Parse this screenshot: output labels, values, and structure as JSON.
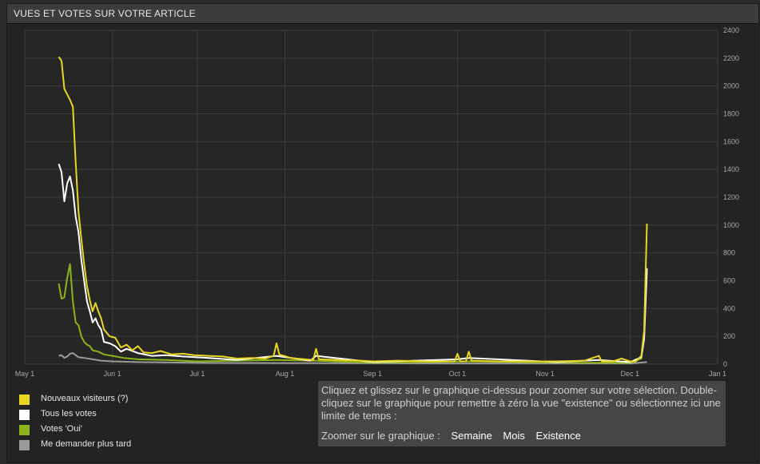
{
  "header": {
    "title": "VUES ET VOTES SUR VOTRE ARTICLE"
  },
  "legend": [
    {
      "label": "Nouveaux visiteurs (?)",
      "color": "#e8d622"
    },
    {
      "label": "Tous les votes",
      "color": "#ffffff"
    },
    {
      "label": "Votes 'Oui'",
      "color": "#8cb418"
    },
    {
      "label": "Me demander plus tard",
      "color": "#9a9a9a"
    }
  ],
  "info": {
    "text": "Cliquez et glissez sur le graphique ci-dessus pour zoomer sur votre sélection. Double-cliquez sur le graphique pour remettre à zéro la vue \"existence\" ou sélectionnez ici une limite de temps :",
    "zoom_label": "Zoomer sur le graphique :",
    "zoom_week": "Semaine",
    "zoom_month": "Mois",
    "zoom_all": "Existence"
  },
  "chart_data": {
    "type": "line",
    "x_tick_labels": [
      "May 1",
      "Jun 1",
      "Jul 1",
      "Aug 1",
      "Sep 1",
      "Oct 1",
      "Nov 1",
      "Dec 1",
      "Jan 1"
    ],
    "y_tick_labels": [
      "0",
      "200",
      "400",
      "600",
      "800",
      "1000",
      "1200",
      "1400",
      "1600",
      "1800",
      "2000",
      "2200",
      "2400"
    ],
    "ylim": [
      0,
      2400
    ],
    "grid": true,
    "legend_position": "bottom-left",
    "series": [
      {
        "name": "Nouveaux visiteurs (?)",
        "color": "#e8d622",
        "points": [
          [
            "2012-05-13",
            2210
          ],
          [
            "2012-05-14",
            2180
          ],
          [
            "2012-05-15",
            1980
          ],
          [
            "2012-05-17",
            1900
          ],
          [
            "2012-05-18",
            1850
          ],
          [
            "2012-05-19",
            1450
          ],
          [
            "2012-05-20",
            1100
          ],
          [
            "2012-05-21",
            900
          ],
          [
            "2012-05-22",
            720
          ],
          [
            "2012-05-23",
            560
          ],
          [
            "2012-05-24",
            460
          ],
          [
            "2012-05-25",
            380
          ],
          [
            "2012-05-26",
            440
          ],
          [
            "2012-05-27",
            380
          ],
          [
            "2012-05-28",
            330
          ],
          [
            "2012-05-29",
            250
          ],
          [
            "2012-05-31",
            200
          ],
          [
            "2012-06-02",
            190
          ],
          [
            "2012-06-04",
            120
          ],
          [
            "2012-06-06",
            140
          ],
          [
            "2012-06-08",
            100
          ],
          [
            "2012-06-10",
            130
          ],
          [
            "2012-06-12",
            85
          ],
          [
            "2012-06-15",
            80
          ],
          [
            "2012-06-18",
            95
          ],
          [
            "2012-06-22",
            70
          ],
          [
            "2012-06-26",
            75
          ],
          [
            "2012-06-30",
            65
          ],
          [
            "2012-07-05",
            60
          ],
          [
            "2012-07-10",
            55
          ],
          [
            "2012-07-15",
            40
          ],
          [
            "2012-07-20",
            45
          ],
          [
            "2012-07-25",
            40
          ],
          [
            "2012-07-28",
            60
          ],
          [
            "2012-07-29",
            150
          ],
          [
            "2012-07-30",
            70
          ],
          [
            "2012-08-03",
            45
          ],
          [
            "2012-08-08",
            35
          ],
          [
            "2012-08-11",
            30
          ],
          [
            "2012-08-12",
            110
          ],
          [
            "2012-08-13",
            35
          ],
          [
            "2012-08-20",
            30
          ],
          [
            "2012-08-28",
            25
          ],
          [
            "2012-09-01",
            20
          ],
          [
            "2012-09-10",
            25
          ],
          [
            "2012-09-20",
            20
          ],
          [
            "2012-09-30",
            20
          ],
          [
            "2012-10-01",
            75
          ],
          [
            "2012-10-02",
            20
          ],
          [
            "2012-10-04",
            20
          ],
          [
            "2012-10-05",
            90
          ],
          [
            "2012-10-06",
            25
          ],
          [
            "2012-10-15",
            20
          ],
          [
            "2012-10-25",
            20
          ],
          [
            "2012-11-05",
            20
          ],
          [
            "2012-11-15",
            25
          ],
          [
            "2012-11-20",
            60
          ],
          [
            "2012-11-21",
            20
          ],
          [
            "2012-11-25",
            20
          ],
          [
            "2012-11-28",
            40
          ],
          [
            "2012-12-01",
            20
          ],
          [
            "2012-12-03",
            20
          ],
          [
            "2012-12-05",
            60
          ],
          [
            "2012-12-06",
            240
          ],
          [
            "2012-12-07",
            1010
          ]
        ]
      },
      {
        "name": "Tous les votes",
        "color": "#ffffff",
        "points": [
          [
            "2012-05-13",
            1440
          ],
          [
            "2012-05-14",
            1380
          ],
          [
            "2012-05-15",
            1170
          ],
          [
            "2012-05-16",
            1300
          ],
          [
            "2012-05-17",
            1350
          ],
          [
            "2012-05-18",
            1250
          ],
          [
            "2012-05-19",
            1060
          ],
          [
            "2012-05-20",
            950
          ],
          [
            "2012-05-21",
            750
          ],
          [
            "2012-05-22",
            600
          ],
          [
            "2012-05-23",
            450
          ],
          [
            "2012-05-24",
            380
          ],
          [
            "2012-05-25",
            300
          ],
          [
            "2012-05-26",
            330
          ],
          [
            "2012-05-27",
            280
          ],
          [
            "2012-05-28",
            250
          ],
          [
            "2012-05-29",
            160
          ],
          [
            "2012-05-31",
            150
          ],
          [
            "2012-06-02",
            130
          ],
          [
            "2012-06-04",
            90
          ],
          [
            "2012-06-06",
            110
          ],
          [
            "2012-06-10",
            80
          ],
          [
            "2012-06-15",
            60
          ],
          [
            "2012-06-20",
            65
          ],
          [
            "2012-06-26",
            55
          ],
          [
            "2012-07-05",
            45
          ],
          [
            "2012-07-15",
            30
          ],
          [
            "2012-07-29",
            60
          ],
          [
            "2012-08-10",
            25
          ],
          [
            "2012-08-12",
            60
          ],
          [
            "2012-09-01",
            15
          ],
          [
            "2012-10-01",
            35
          ],
          [
            "2012-10-05",
            45
          ],
          [
            "2012-11-05",
            15
          ],
          [
            "2012-11-20",
            30
          ],
          [
            "2012-12-01",
            15
          ],
          [
            "2012-12-05",
            50
          ],
          [
            "2012-12-06",
            180
          ],
          [
            "2012-12-07",
            690
          ]
        ]
      },
      {
        "name": "Votes 'Oui'",
        "color": "#8cb418",
        "points": [
          [
            "2012-05-13",
            580
          ],
          [
            "2012-05-14",
            470
          ],
          [
            "2012-05-15",
            480
          ],
          [
            "2012-05-16",
            620
          ],
          [
            "2012-05-17",
            720
          ],
          [
            "2012-05-18",
            450
          ],
          [
            "2012-05-19",
            300
          ],
          [
            "2012-05-20",
            280
          ],
          [
            "2012-05-21",
            200
          ],
          [
            "2012-05-22",
            160
          ],
          [
            "2012-05-23",
            140
          ],
          [
            "2012-05-24",
            130
          ],
          [
            "2012-05-25",
            100
          ],
          [
            "2012-05-27",
            90
          ],
          [
            "2012-05-29",
            70
          ],
          [
            "2012-06-01",
            60
          ],
          [
            "2012-06-05",
            45
          ],
          [
            "2012-06-10",
            35
          ],
          [
            "2012-06-20",
            30
          ],
          [
            "2012-07-01",
            20
          ],
          [
            "2012-07-29",
            30
          ],
          [
            "2012-08-12",
            25
          ],
          [
            "2012-09-01",
            10
          ],
          [
            "2012-10-05",
            20
          ],
          [
            "2012-11-15",
            10
          ],
          [
            "2012-12-01",
            10
          ],
          [
            "2012-12-05",
            40
          ],
          [
            "2012-12-06",
            200
          ],
          [
            "2012-12-07",
            660
          ]
        ]
      },
      {
        "name": "Me demander plus tard",
        "color": "#9a9a9a",
        "points": [
          [
            "2012-05-13",
            60
          ],
          [
            "2012-05-14",
            65
          ],
          [
            "2012-05-15",
            45
          ],
          [
            "2012-05-16",
            55
          ],
          [
            "2012-05-17",
            75
          ],
          [
            "2012-05-18",
            80
          ],
          [
            "2012-05-19",
            65
          ],
          [
            "2012-05-20",
            50
          ],
          [
            "2012-05-22",
            45
          ],
          [
            "2012-05-25",
            35
          ],
          [
            "2012-05-28",
            25
          ],
          [
            "2012-06-01",
            20
          ],
          [
            "2012-06-10",
            15
          ],
          [
            "2012-07-01",
            10
          ],
          [
            "2012-08-01",
            8
          ],
          [
            "2012-10-01",
            5
          ],
          [
            "2012-12-01",
            5
          ],
          [
            "2012-12-07",
            15
          ]
        ]
      }
    ]
  }
}
